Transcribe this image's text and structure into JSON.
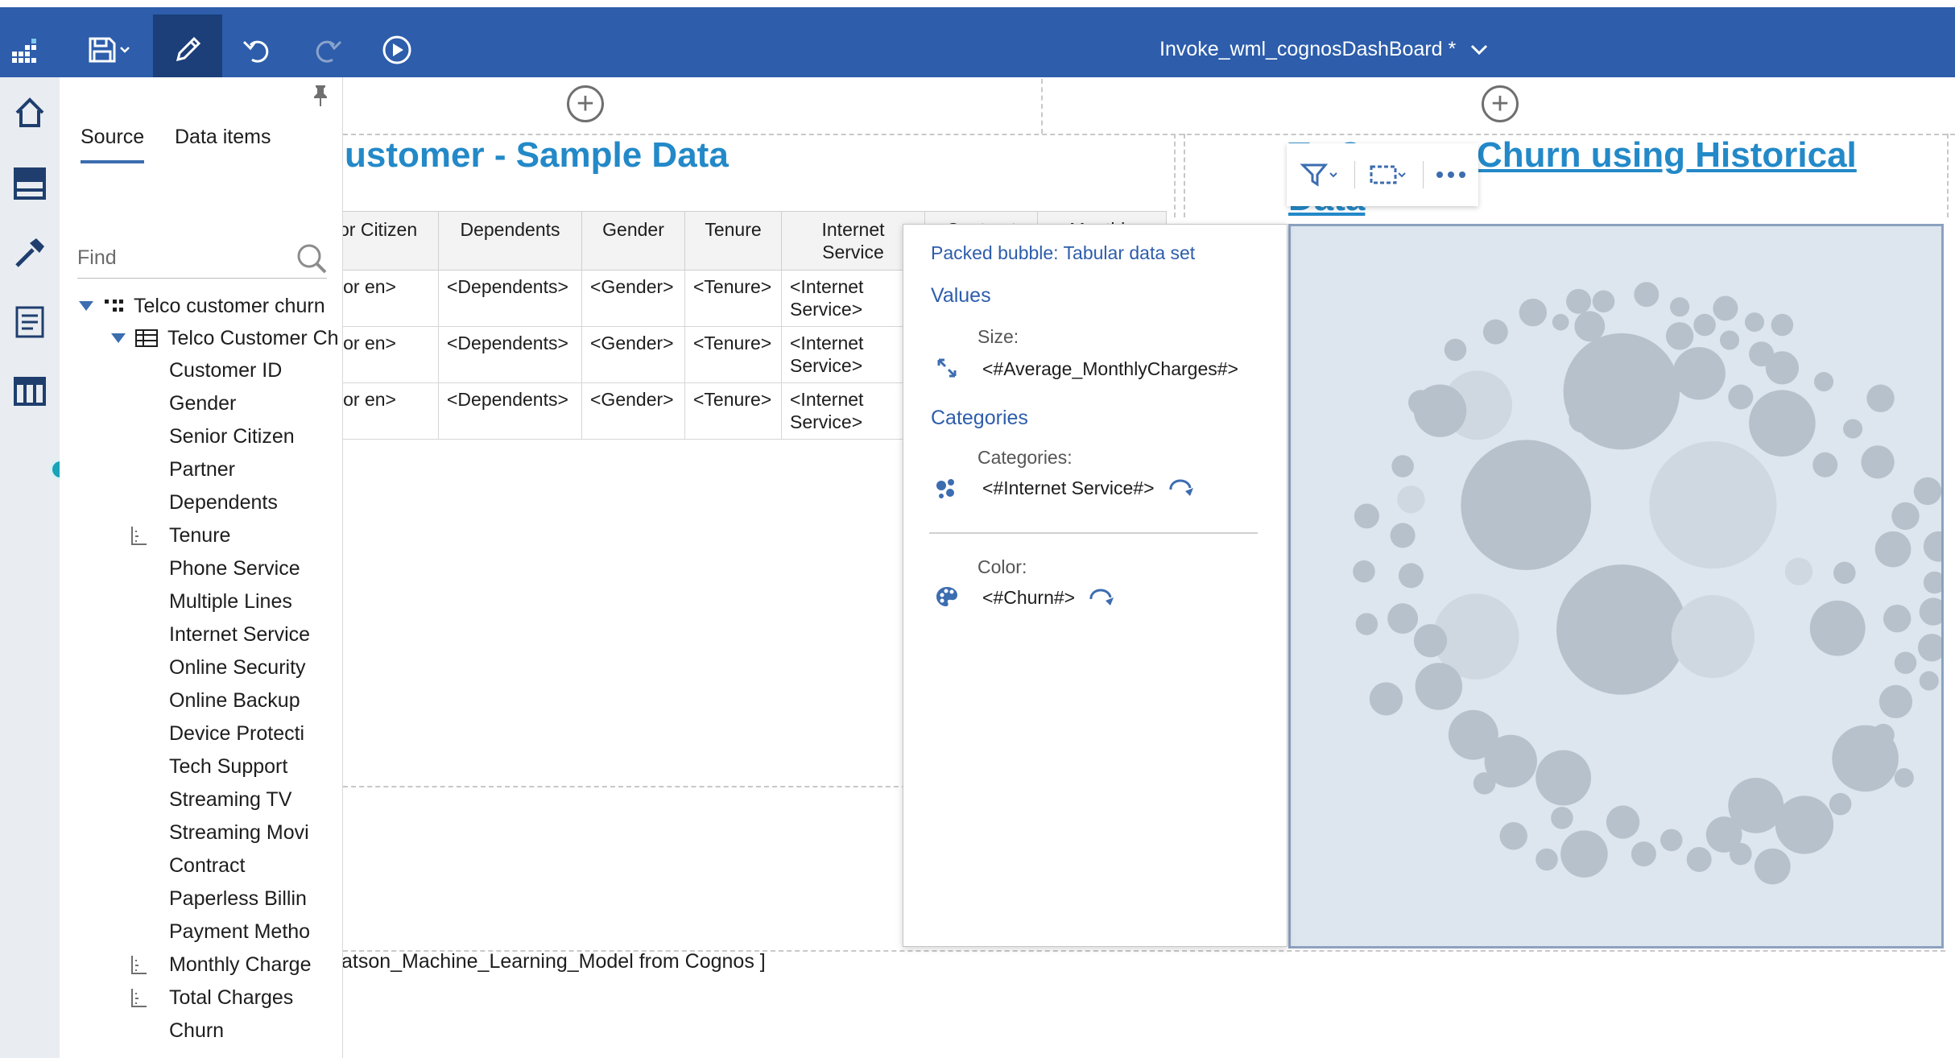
{
  "app": {
    "document_title": "Invoke_wml_cognosDashBoard *"
  },
  "toolbar": {
    "icons": [
      "app-menu-icon",
      "save-icon",
      "edit-icon",
      "undo-icon",
      "redo-icon",
      "play-icon"
    ]
  },
  "rail": {
    "icons": [
      "home-icon",
      "data-icon",
      "tools-icon",
      "page-icon",
      "visualization-icon"
    ]
  },
  "canvas": {
    "left_widget_title": "ustomer - Sample Data",
    "right_widget_title_line1": "Telco Customer Churn using Historical",
    "right_widget_title_line2": "Data",
    "right_widget_title_visible_1": "Te  C  s  mer Churn using Historical",
    "bottom_text": "atson_Machine_Learning_Model from Cognos  ]"
  },
  "table": {
    "headers": [
      "or Citizen",
      "Dependents",
      "Gender",
      "Tenure",
      "Internet Service",
      "Contract",
      "Monthly"
    ],
    "rows": [
      [
        "ior en>",
        "<Dependents>",
        "<Gender>",
        "<Tenure>",
        "<Internet Service>"
      ],
      [
        "ior en>",
        "<Dependents>",
        "<Gender>",
        "<Tenure>",
        "<Internet Service>"
      ],
      [
        "ior en>",
        "<Dependents>",
        "<Gender>",
        "<Tenure>",
        "<Internet Service>"
      ]
    ]
  },
  "source_panel": {
    "tabs": [
      "Source",
      "Data items"
    ],
    "active_tab": "Source",
    "find_placeholder": "Find",
    "tree": {
      "root": "Telco customer churn",
      "table": "Telco Customer Ch",
      "items": [
        {
          "label": "Customer ID",
          "measure": false
        },
        {
          "label": "Gender",
          "measure": false
        },
        {
          "label": "Senior Citizen",
          "measure": false
        },
        {
          "label": "Partner",
          "measure": false
        },
        {
          "label": "Dependents",
          "measure": false
        },
        {
          "label": "Tenure",
          "measure": true
        },
        {
          "label": "Phone Service",
          "measure": false
        },
        {
          "label": "Multiple Lines",
          "measure": false
        },
        {
          "label": "Internet Service",
          "measure": false
        },
        {
          "label": "Online Security",
          "measure": false
        },
        {
          "label": "Online Backup",
          "measure": false
        },
        {
          "label": "Device Protecti",
          "measure": false
        },
        {
          "label": "Tech Support",
          "measure": false
        },
        {
          "label": "Streaming TV",
          "measure": false
        },
        {
          "label": "Streaming Movi",
          "measure": false
        },
        {
          "label": "Contract",
          "measure": false
        },
        {
          "label": "Paperless Billin",
          "measure": false
        },
        {
          "label": "Payment Metho",
          "measure": false
        },
        {
          "label": "Monthly Charge",
          "measure": true
        },
        {
          "label": "Total Charges",
          "measure": true
        },
        {
          "label": "Churn",
          "measure": false
        }
      ]
    }
  },
  "popover": {
    "title": "Packed bubble: Tabular data set",
    "values_heading": "Values",
    "size_label": "Size:",
    "size_value": "<#Average_MonthlyCharges#>",
    "categories_heading": "Categories",
    "categories_label": "Categories:",
    "categories_value": "<#Internet Service#>",
    "color_label": "Color:",
    "color_value": "<#Churn#>"
  },
  "chart_toolbar": {
    "icons": [
      "filter-icon",
      "select-icon",
      "more-icon"
    ]
  },
  "colors": {
    "topbar": "#2d5dab",
    "accent": "#2389c8",
    "bubble": "#b6c1cb",
    "bubble_light": "#cfd8e0",
    "chart_bg": "#dde5ee"
  }
}
